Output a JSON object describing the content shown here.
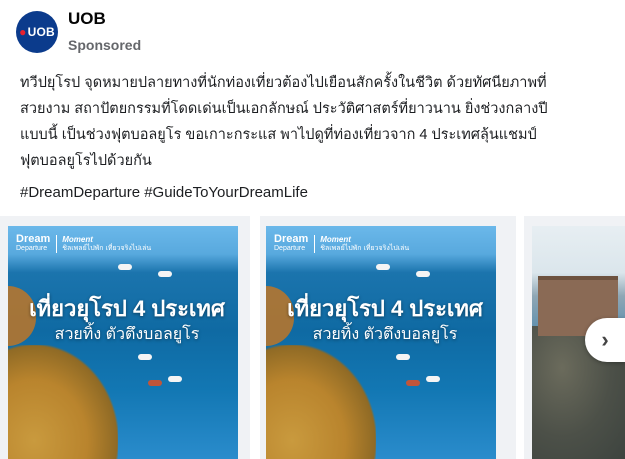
{
  "header": {
    "avatar_text": "UOB",
    "page_name": "UOB",
    "sponsored_label": "Sponsored"
  },
  "post": {
    "text": "ทวีปยุโรป จุดหมายปลายทางที่นักท่องเที่ยวต้องไปเยือนสักครั้งในชีวิต ด้วยทัศนียภาพที่\nสวยงาม สถาปัตยกรรมที่โดดเด่นเป็นเอกลักษณ์ ประวัติศาสตร์ที่ยาวนาน ยิ่งช่วงกลางปี\nแบบนี้ เป็นช่วงฟุตบอลยูโร ขอเกาะกระแส พาไปดูที่ท่องเที่ยวจาก 4 ประเทศลุ้นแชมป์\nฟุตบอลยูโรไปด้วยกัน",
    "hashtags": "#DreamDeparture #GuideToYourDreamLife"
  },
  "carousel": {
    "cards": [
      {
        "logo_main": "Dream",
        "logo_sub": "Departure",
        "moment_title": "Moment",
        "moment_sub": "ชิลเพลย์ไปพัก เที่ยวจริงไปเล่น",
        "headline": "เที่ยวยุโรป 4 ประเทศ",
        "subline": "สวยทิ้ง ตัวตึงบอลยูโร"
      },
      {
        "logo_main": "Dream",
        "logo_sub": "Departure",
        "moment_title": "Moment",
        "moment_sub": "ชิลเพลย์ไปพัก เที่ยวจริงไปเล่น",
        "headline": "เที่ยวยุโรป 4 ประเทศ",
        "subline": "สวยทิ้ง ตัวตึงบอลยูโร"
      }
    ],
    "next_icon": "chevron-right-icon",
    "next_glyph": "›"
  }
}
